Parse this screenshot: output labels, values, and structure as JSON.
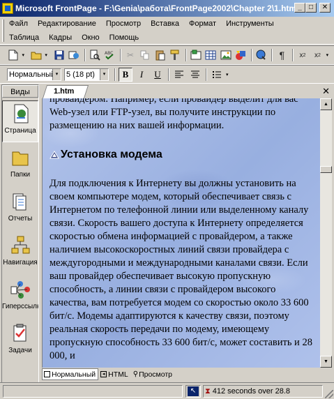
{
  "window": {
    "title": "Microsoft FrontPage - F:\\Genia\\работа\\FrontPage2002\\Chapter 2\\1.htm"
  },
  "menu": {
    "row1": [
      "Файл",
      "Редактирование",
      "Просмотр",
      "Вставка",
      "Формат",
      "Инструменты"
    ],
    "row2": [
      "Таблица",
      "Кадры",
      "Окно",
      "Помощь"
    ]
  },
  "format": {
    "style_value": "Нормальный",
    "size_value": "5  (18 pt)"
  },
  "views_bar": {
    "header": "Виды",
    "items": [
      "Страница",
      "Папки",
      "Отчеты",
      "Навигация",
      "Гиперссылки",
      "Задачи"
    ]
  },
  "doc_tab": {
    "label": "1.htm"
  },
  "document": {
    "intro": "провайдером. Например, если провайдер выделит для вас Web-узел или FTP-узел, вы получите инструкции по размещению на них вашей информации.",
    "heading": "Установка модема",
    "body": "Для подключения к Интернету вы должны установить на своем компьютере модем, который обеспечивает связь с Интернетом по телефонной линии или выделенному каналу связи. Скорость вашего доступа к Интернету определяется скоростью обмена информацией с провайдером, а также наличием высокоскоростных линий связи провайдера с междугородными и международными каналами связи. Если ваш провайдер обеспечивает высокую пропускную способность, а линии связи с провайдером высокого качества, вам потребуется модем со скоростью около 33 600 бит/с. Модемы адаптируются к качеству связи, поэтому реальная скорость передачи по модему, имеющему пропускную способность 33 600 бит/с, может составить и 28 000, и"
  },
  "view_tabs": [
    "Нормальный",
    "HTML",
    "Просмотр"
  ],
  "status": {
    "download_time": "412 seconds over 28.8"
  }
}
